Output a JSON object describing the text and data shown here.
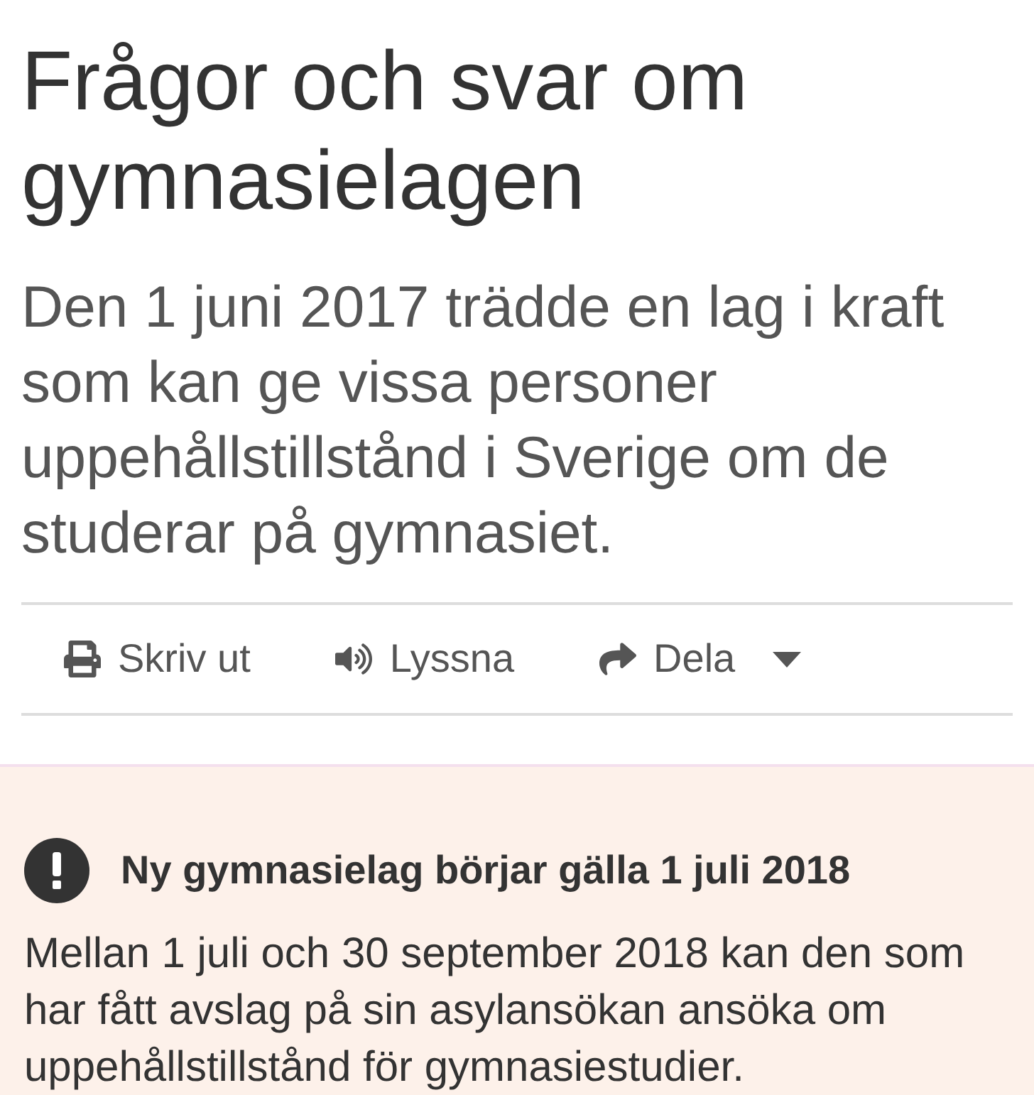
{
  "title": "Frågor och svar om gymnasielagen",
  "intro": "Den 1 juni 2017 trädde en lag i kraft som kan ge vissa personer uppehållstillstånd i Sverige om de studerar på gymnasiet.",
  "actions": [
    {
      "kind": "print",
      "label": "Skriv ut"
    },
    {
      "kind": "listen",
      "label": "Lyssna"
    },
    {
      "kind": "share",
      "label": "Dela",
      "dropdown": true
    }
  ],
  "notice": {
    "title": "Ny gymnasielag börjar gälla 1 juli 2018",
    "body": "Mellan 1 juli och 30 september 2018 kan den som har fått avslag på sin asylansökan ansöka om uppehållstillstånd för gymnasiestudier."
  }
}
